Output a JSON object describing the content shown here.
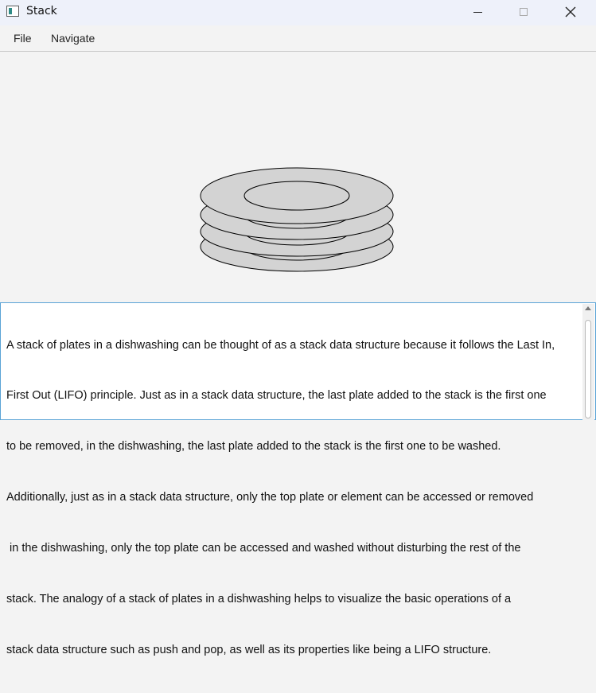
{
  "window": {
    "title": "Stack",
    "controls": [
      "minimize-icon",
      "maximize-icon",
      "close-icon"
    ]
  },
  "menu": {
    "items": [
      "File",
      "Navigate"
    ]
  },
  "illustration": {
    "subject": "stack-of-plates",
    "plate_count": 4,
    "colors": {
      "plate_fill": "#d3d3d3",
      "outline": "#000000"
    }
  },
  "description": {
    "lines": [
      "A stack of plates in a dishwashing can be thought of as a stack data structure because it follows the Last In,",
      "First Out (LIFO) principle. Just as in a stack data structure, the last plate added to the stack is the first one",
      "to be removed, in the dishwashing, the last plate added to the stack is the first one to be washed.",
      "Additionally, just as in a stack data structure, only the top plate or element can be accessed or removed",
      " in the dishwashing, only the top plate can be accessed and washed without disturbing the rest of the",
      "stack. The analogy of a stack of plates in a dishwashing helps to visualize the basic operations of a",
      "stack data structure such as push and pop, as well as its properties like being a LIFO structure."
    ]
  },
  "colors": {
    "titlebar": "#eef1fa",
    "focus_border": "#5aa3d6"
  }
}
